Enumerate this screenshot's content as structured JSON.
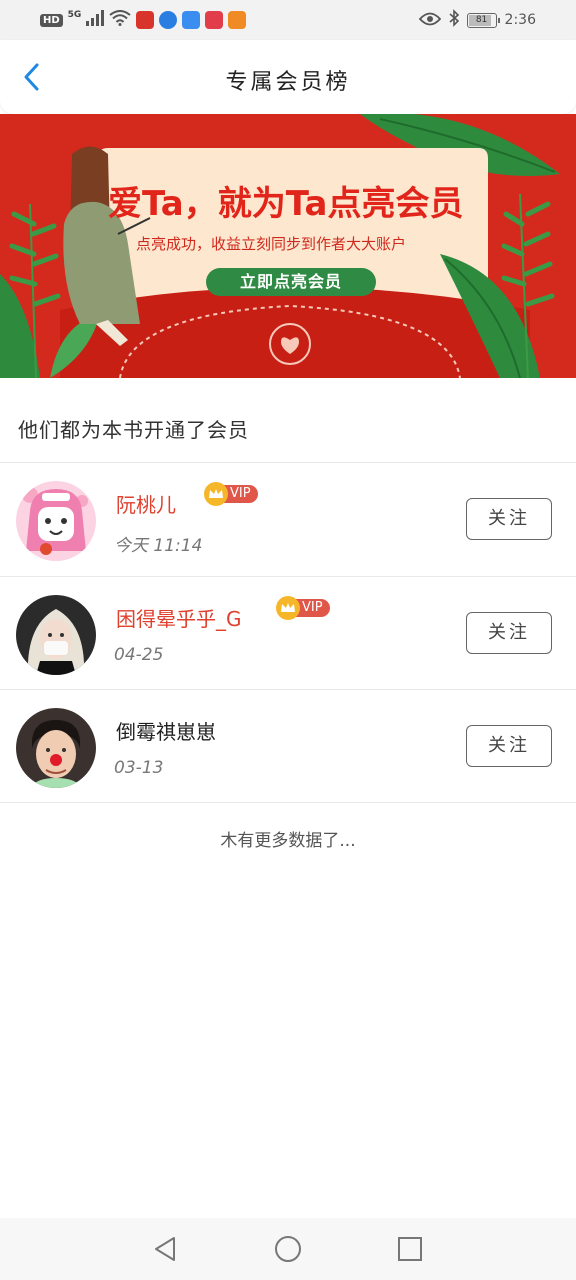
{
  "status_bar": {
    "network": "HD",
    "signal": "5G",
    "battery": "81",
    "time": "2:36",
    "icons": [
      "signal-icon",
      "wifi-icon",
      "book-app-icon",
      "browser-app-icon",
      "cloud-app-icon",
      "game-app-icon",
      "video-app-icon",
      "eye-icon",
      "bluetooth-icon",
      "battery-icon"
    ]
  },
  "header": {
    "title": "专属会员榜",
    "back_icon": "chevron-left-icon"
  },
  "banner": {
    "headline": "爱Ta，就为Ta点亮会员",
    "subtitle": "点亮成功，收益立刻同步到作者大大账户",
    "cta": "立即点亮会员"
  },
  "section": {
    "title": "他们都为本书开通了会员"
  },
  "members": [
    {
      "name": "阮桃儿",
      "is_vip": true,
      "vip_label": "VIP",
      "date": "今天 11:14",
      "follow_label": "关注"
    },
    {
      "name": "困得晕乎乎_G",
      "is_vip": true,
      "vip_label": "VIP",
      "date": "04-25",
      "follow_label": "关注"
    },
    {
      "name": "倒霉祺崽崽",
      "is_vip": false,
      "date": "03-13",
      "follow_label": "关注"
    }
  ],
  "footer_note": "木有更多数据了...",
  "nav_bar": {
    "icons": [
      "back-triangle-icon",
      "home-circle-icon",
      "recents-square-icon"
    ]
  },
  "colors": {
    "accent_blue": "#1e88e5",
    "banner_red": "#d42a1e",
    "vip_name": "#e0412f",
    "cta_green": "#2f8a43"
  }
}
